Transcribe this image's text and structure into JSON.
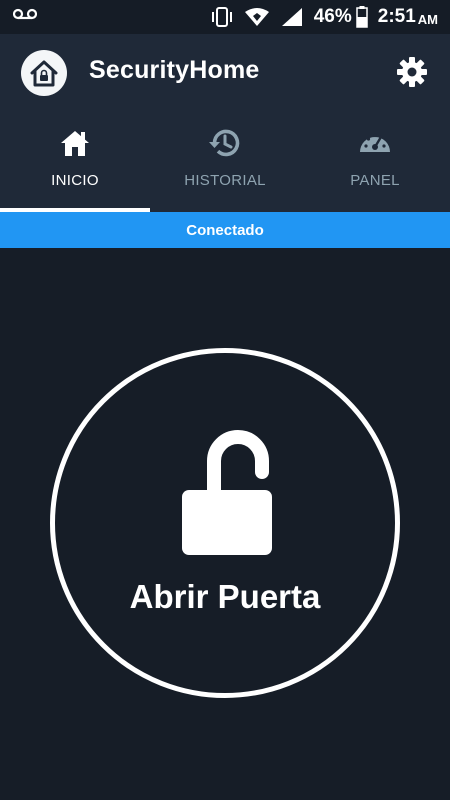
{
  "status_bar": {
    "battery_percent": "46%",
    "time": "2:51",
    "ampm": "AM",
    "icons": [
      "voicemail-icon",
      "vibrate-icon",
      "wifi-icon",
      "signal-icon",
      "battery-icon"
    ]
  },
  "app": {
    "title": "SecurityHome",
    "logo_icon": "home-lock-icon",
    "settings_icon": "gear-icon"
  },
  "tabs": [
    {
      "label": "INICIO",
      "icon": "home-icon",
      "active": true
    },
    {
      "label": "HISTORIAL",
      "icon": "history-icon",
      "active": false
    },
    {
      "label": "PANEL",
      "icon": "speedometer-icon",
      "active": false
    }
  ],
  "connection": {
    "status": "Conectado",
    "color": "#2196f3"
  },
  "door": {
    "label": "Abrir Puerta",
    "icon": "unlock-icon"
  },
  "colors": {
    "background": "#161d27",
    "app_bar": "#1f2938",
    "tab_inactive": "#8ea3b0",
    "accent": "#2196f3"
  }
}
